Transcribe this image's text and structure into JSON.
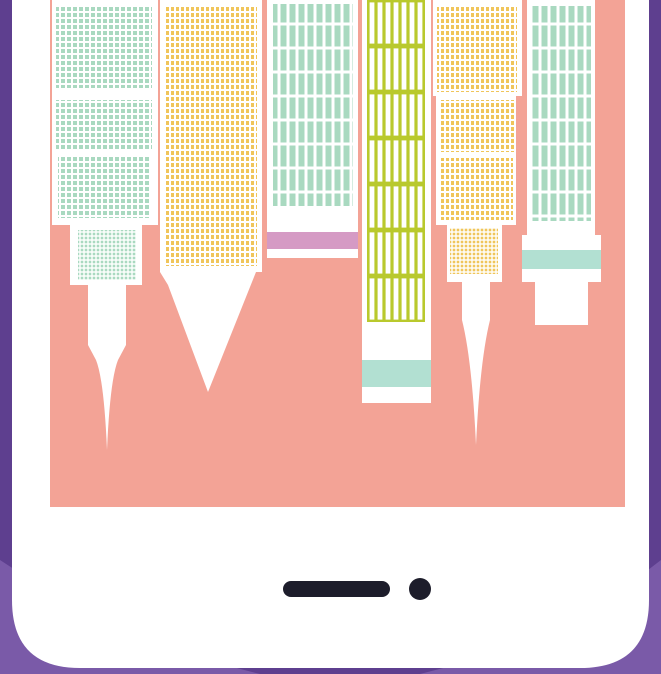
{
  "image": {
    "subject": "phone-with-inverted-skyline",
    "colors": {
      "background_purple": "#5e3f8f",
      "background_purple_light": "#7a5aa8",
      "phone_body": "#ffffff",
      "screen_salmon": "#f3a396",
      "window_green": "#a9d9c0",
      "window_yellow": "#f0c55a",
      "window_lime": "#b9c92d",
      "band_mint": "#b2e0d2",
      "band_purple": "#d59ac4",
      "home_bar": "#1d1d2b"
    }
  }
}
